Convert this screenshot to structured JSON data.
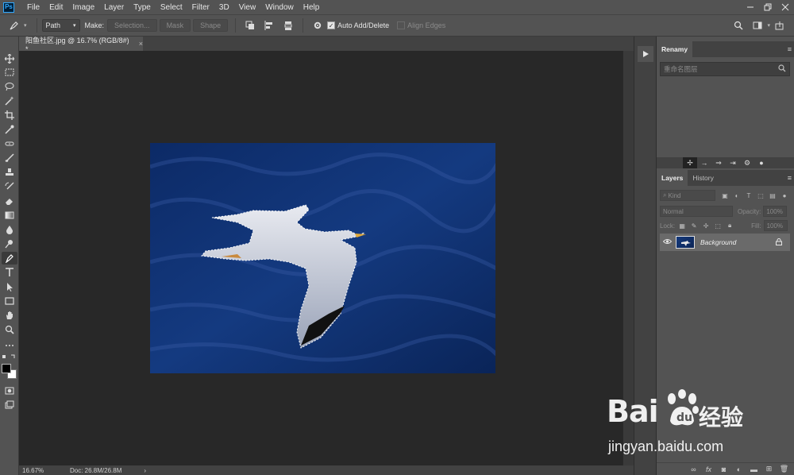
{
  "menubar": {
    "app_icon": "Ps",
    "items": [
      "File",
      "Edit",
      "Image",
      "Layer",
      "Type",
      "Select",
      "Filter",
      "3D",
      "View",
      "Window",
      "Help"
    ]
  },
  "optionsbar": {
    "mode": "Path",
    "make_label": "Make:",
    "selection_btn": "Selection...",
    "mask_btn": "Mask",
    "shape_btn": "Shape",
    "auto_add_delete": "Auto Add/Delete",
    "auto_add_delete_checked": true,
    "align_edges": "Align Edges",
    "align_edges_checked": false
  },
  "document": {
    "tab_title": "阳鱼社区.jpg @ 16.7% (RGB/8#) *",
    "close": "×"
  },
  "statusbar": {
    "zoom": "16.67%",
    "doc": "Doc: 26.8M/26.8M",
    "arrow": "›"
  },
  "renamy_panel": {
    "title": "Renamy",
    "search_placeholder": "重命名图层"
  },
  "layers_panel": {
    "tabs": [
      "Layers",
      "History"
    ],
    "active_tab": "Layers",
    "kind_label": "Kind",
    "blend_mode": "Normal",
    "opacity_label": "Opacity:",
    "opacity_value": "100%",
    "lock_label": "Lock:",
    "fill_label": "Fill:",
    "fill_value": "100%",
    "layers": [
      {
        "name": "Background",
        "visible": true,
        "locked": true
      }
    ]
  },
  "watermark": {
    "brand": "Bai",
    "brand2": "经验",
    "url": "jingyan.baidu.com"
  },
  "colors": {
    "ui_dark": "#282828",
    "ui_panel": "#535353",
    "ps_blue": "#31a8ff",
    "sea": "#12306b"
  }
}
